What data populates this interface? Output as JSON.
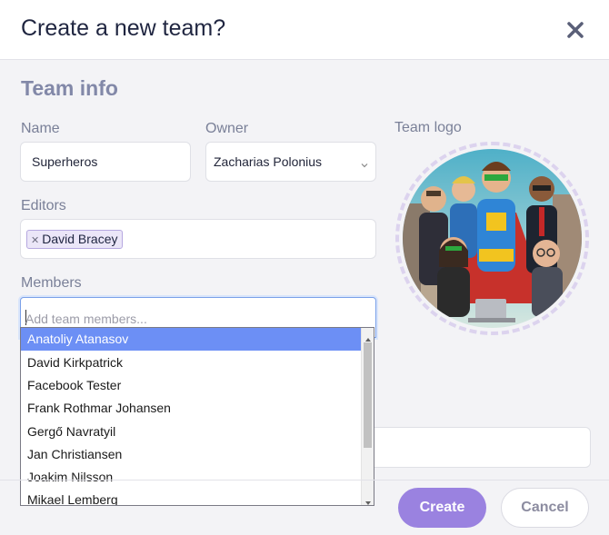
{
  "dialog": {
    "title": "Create a new team?",
    "section_title": "Team info",
    "close_icon": "close-icon"
  },
  "fields": {
    "name_label": "Name",
    "name_value": "Superheros",
    "owner_label": "Owner",
    "owner_value": "Zacharias Polonius",
    "editors_label": "Editors",
    "editors": [
      "David Bracey"
    ],
    "members_label": "Members",
    "members_placeholder": "Add team members...",
    "logo_label": "Team logo"
  },
  "dropdown": {
    "options": [
      "Anatoliy Atanasov",
      "David Kirkpatrick",
      "Facebook Tester",
      "Frank Rothmar Johansen",
      "Gergő Navratyil",
      "Jan Christiansen",
      "Joakim Nilsson",
      "Mikael Lemberg"
    ],
    "highlighted": "Anatoliy Atanasov"
  },
  "buttons": {
    "create": "Create",
    "cancel": "Cancel"
  },
  "colors": {
    "accent": "#9a82e0",
    "highlight": "#6c8ff5"
  }
}
